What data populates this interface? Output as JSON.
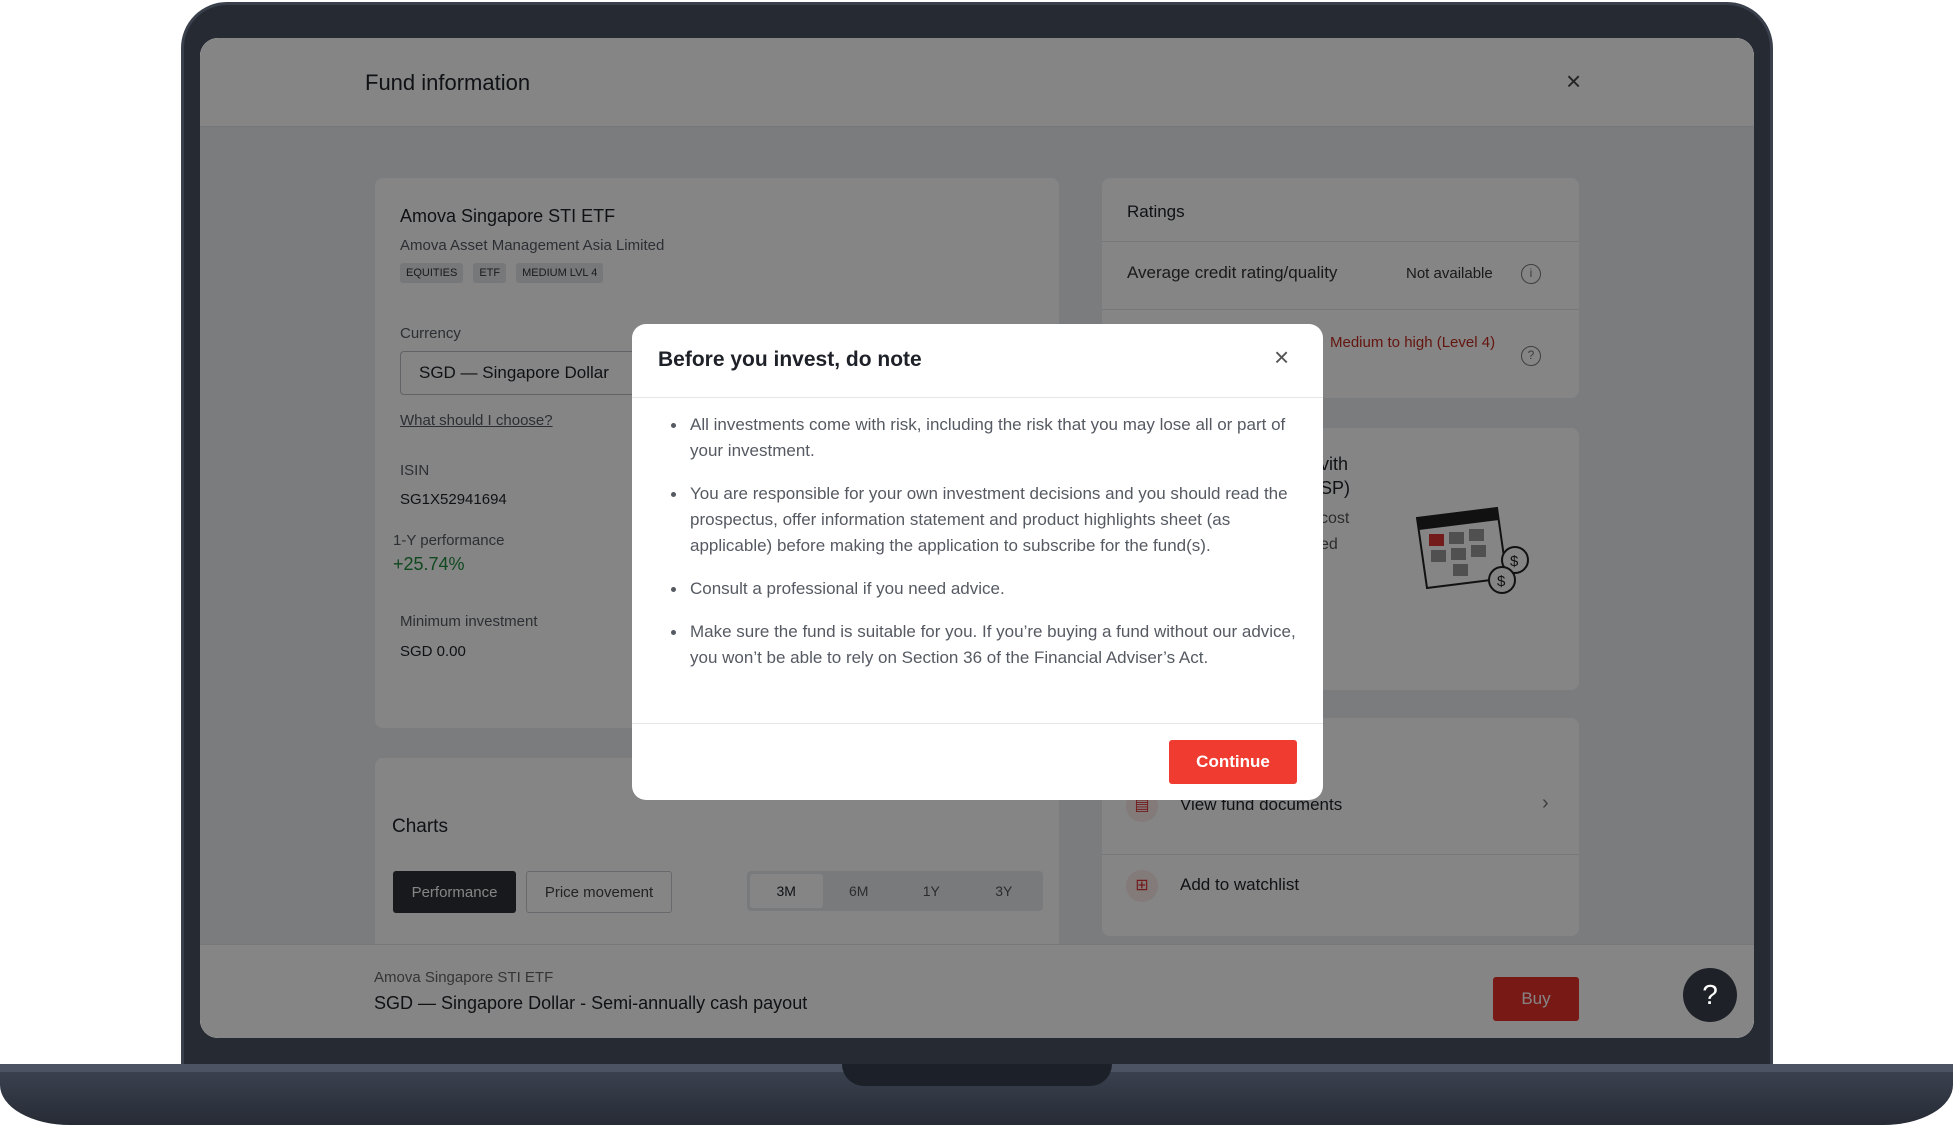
{
  "app": {
    "title": "Fund information",
    "close_icon": "×"
  },
  "fund": {
    "name": "Amova Singapore STI ETF",
    "manager": "Amova Asset Management Asia Limited",
    "tags": [
      "EQUITIES",
      "ETF",
      "MEDIUM LVL 4"
    ],
    "currency_label": "Currency",
    "currency_value": "SGD — Singapore Dollar",
    "currency_help_link": "What should I choose?",
    "isin_label": "ISIN",
    "isin_value": "SG1X52941694",
    "perf_label": "1-Y performance",
    "perf_value": "+25.74%",
    "min_invest_label": "Minimum investment",
    "min_invest_value": "SGD 0.00"
  },
  "charts": {
    "title": "Charts",
    "tab_performance": "Performance",
    "tab_price": "Price movement",
    "ranges": [
      "3M",
      "6M",
      "1Y",
      "3Y"
    ],
    "selected_range": "3M"
  },
  "ratings": {
    "title": "Ratings",
    "credit_label": "Average credit rating/quality",
    "credit_value": "Not available",
    "risk_value": "Medium to high (Level 4)"
  },
  "rsp": {
    "fragment_1": "vith",
    "fragment_2": "SP)",
    "fragment_3": "cost",
    "fragment_4": "ed"
  },
  "actions": {
    "view_docs": "View fund documents",
    "watchlist": "Add to watchlist"
  },
  "bottom_bar": {
    "fund_name": "Amova Singapore STI ETF",
    "currency_payout": "SGD — Singapore Dollar - Semi-annually cash payout",
    "buy_label": "Buy",
    "help_label": "?"
  },
  "modal": {
    "title": "Before you invest, do note",
    "close_icon": "×",
    "items": [
      "All investments come with risk, including the risk that you may lose all or part of your investment.",
      "You are responsible for your own investment decisions and you should read the prospectus, offer information statement and product highlights sheet (as applicable) before making the application to subscribe for the fund(s).",
      "Consult a professional if you need advice.",
      "Make sure the fund is suitable for you. If you’re buying a fund without our advice, you won’t be able to rely on Section 36 of the Financial Adviser’s Act."
    ],
    "continue_label": "Continue"
  },
  "colors": {
    "accent_red": "#ef3b30",
    "positive_green": "#1f8a3c",
    "risk_red": "#c02a1e",
    "dark": "#1e2228"
  }
}
